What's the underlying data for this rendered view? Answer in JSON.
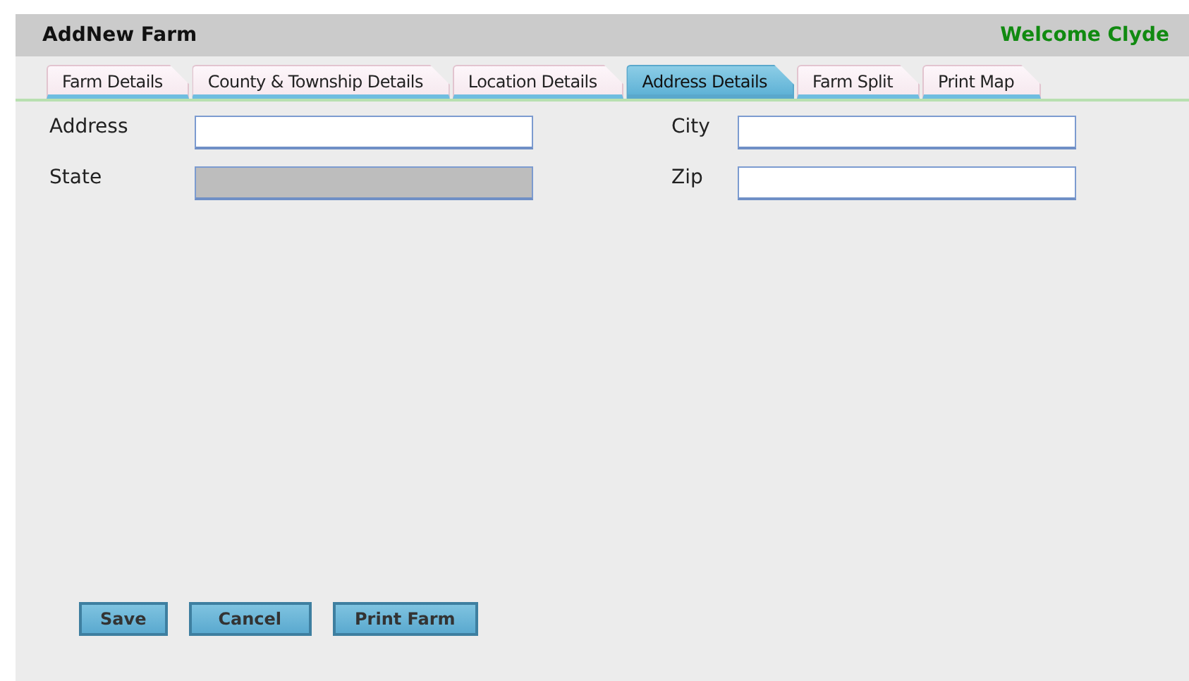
{
  "header": {
    "title": "AddNew Farm",
    "welcome": "Welcome Clyde"
  },
  "tabs": [
    {
      "label": "Farm Details",
      "selected": false
    },
    {
      "label": "County & Township Details",
      "selected": false
    },
    {
      "label": "Location Details",
      "selected": false
    },
    {
      "label": "Address Details",
      "selected": true
    },
    {
      "label": "Farm Split",
      "selected": false
    },
    {
      "label": "Print Map",
      "selected": false
    }
  ],
  "fields": [
    {
      "label": "Address",
      "disabled": false
    },
    {
      "label": "City",
      "disabled": false
    },
    {
      "label": "State",
      "disabled": true
    },
    {
      "label": "Zip",
      "disabled": false
    }
  ],
  "buttons": [
    "Save",
    "Cancel",
    "Print Farm"
  ]
}
